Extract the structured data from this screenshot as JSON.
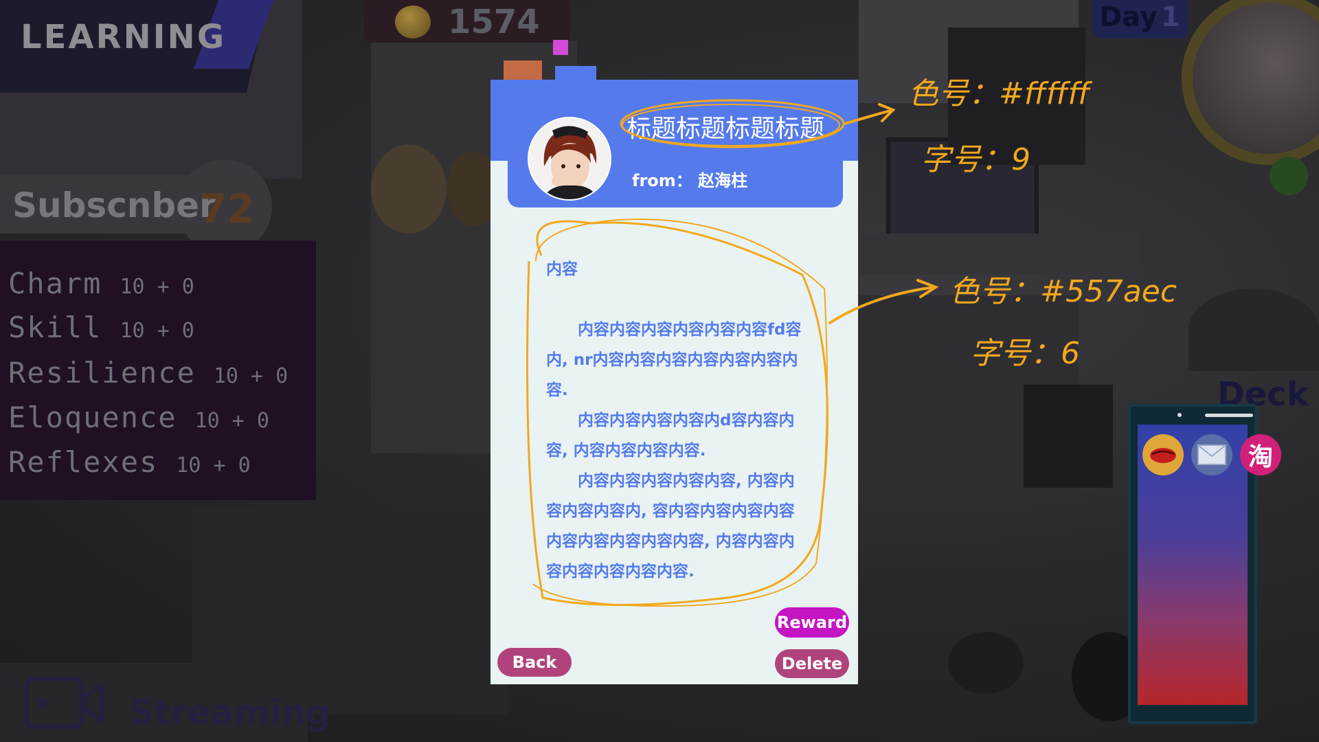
{
  "hud": {
    "mode_label": "LEARNING",
    "subscriber_label": "Subscnber",
    "subscriber_value": "72",
    "coins": "1574",
    "day_label": "Day",
    "day_value": "1",
    "deck_label": "Deck",
    "streaming_label": "Streaming",
    "stats": [
      {
        "name": "Charm",
        "value": "10 + 0"
      },
      {
        "name": "Skill",
        "value": "10 + 0"
      },
      {
        "name": "Resilience",
        "value": "10 + 0"
      },
      {
        "name": "Eloquence",
        "value": "10 + 0"
      },
      {
        "name": "Reflexes",
        "value": "10 + 0"
      }
    ]
  },
  "phone": {
    "apps": [
      {
        "name": "eye-app-icon"
      },
      {
        "name": "mail-app-icon"
      },
      {
        "name": "taobao-app-icon",
        "glyph": "淘"
      }
    ]
  },
  "mail": {
    "title": "标题标题标题标题",
    "from": "from： 赵海柱",
    "content_label": "内容",
    "paragraphs": [
      "内容内容内容内容内容内容fd容内, nr内容内容内容内容内容内容内容.",
      "内容内容内容内容内d容内容内容, 内容内容内容内容.",
      "内容内容内容内容内容, 内容内容内容内容内, 容内容内容内容内容内容内容内容内容内容, 内容内容内容内容内容内容内容."
    ],
    "buttons": {
      "reward": "Reward",
      "back": "Back",
      "delete": "Delete"
    },
    "colors": {
      "header": "#557aec",
      "title_text": "#ffffff",
      "body_text": "#557aec",
      "reward_button": "#c414c4",
      "action_button": "#b0437c"
    }
  },
  "annotations": {
    "color": "#f2a81d",
    "title_note_color": "色号：#ffffff",
    "title_note_size": "字号：9",
    "body_note_color": "色号：#557aec",
    "body_note_size": "字号：6"
  }
}
